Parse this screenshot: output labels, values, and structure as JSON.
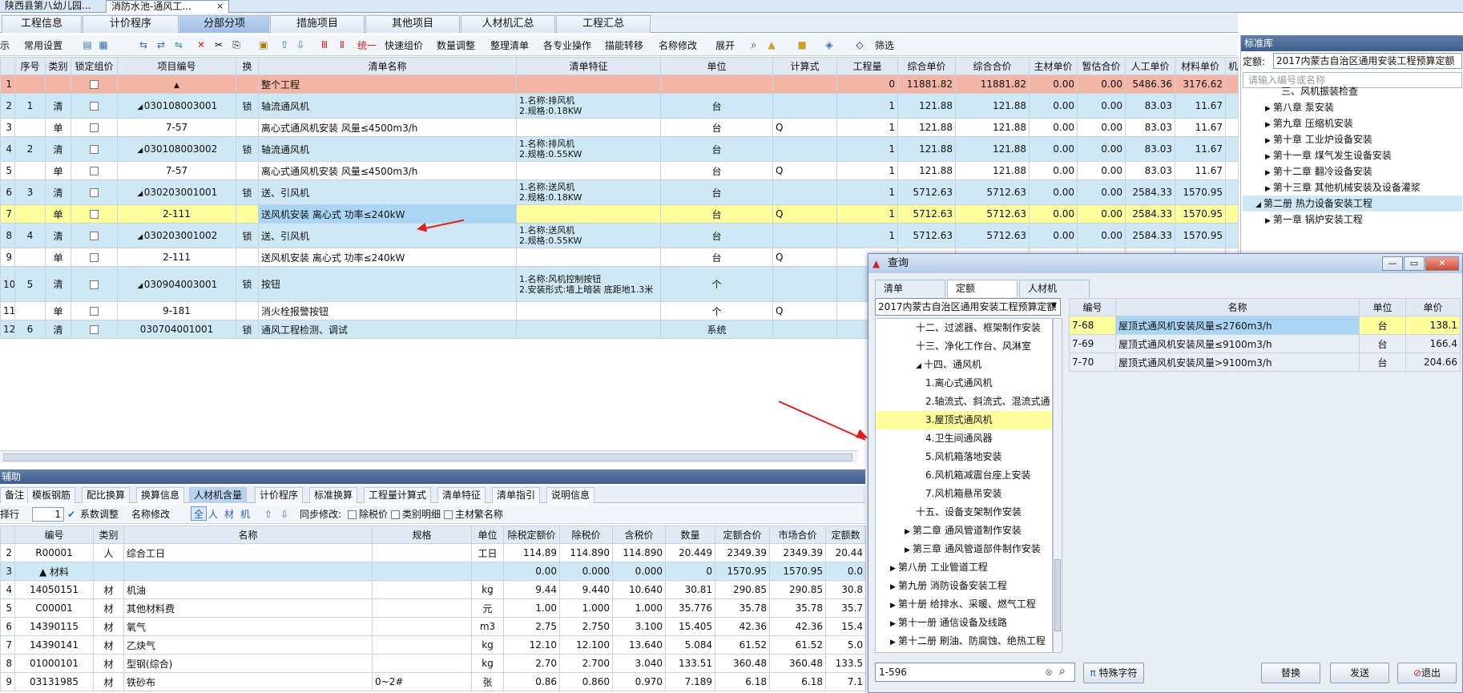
{
  "doc_tabs": [
    "陕西县第八幼儿园...",
    "消防水池-通风工...",
    "×"
  ],
  "main_tabs": [
    "工程信息",
    "计价程序",
    "分部分项",
    "措施项目",
    "其他项目",
    "人材机汇总",
    "工程汇总"
  ],
  "toolbar": [
    "示",
    "常用设置",
    "统一",
    "快速组价",
    "数量调整",
    "整理清单",
    "各专业操作",
    "描能转移",
    "名称修改",
    "展开",
    "筛选"
  ],
  "grid_headers": [
    "序号",
    "类别",
    "锁定组价",
    "项目编号",
    "换",
    "清单名称",
    "清单特征",
    "单位",
    "计算式",
    "工程量",
    "综合单价",
    "综合合价",
    "主材单价",
    "暂估合价",
    "人工单价",
    "材料单价",
    "机"
  ],
  "grid_rows": [
    {
      "n": "1",
      "seq": "",
      "type": "",
      "code": "",
      "name": "整个工程",
      "feat": "",
      "unit": "",
      "calc": "",
      "qty": "0",
      "up": "11881.82",
      "tp": "11881.82",
      "m": "0.00",
      "z": "0.00",
      "rg": "5486.36",
      "cl": "3176.62",
      "style": "salmon",
      "tri": "▲",
      "lock": ""
    },
    {
      "n": "2",
      "seq": "1",
      "type": "清",
      "code": "030108003001",
      "name": "轴流通风机",
      "feat": "1.名称:排风机\n2.规格:0.18KW",
      "unit": "台",
      "calc": "",
      "qty": "1",
      "up": "121.88",
      "tp": "121.88",
      "m": "0.00",
      "z": "0.00",
      "rg": "83.03",
      "cl": "11.67",
      "style": "blue",
      "tri": "◢",
      "lock": "锁"
    },
    {
      "n": "3",
      "seq": "",
      "type": "单",
      "code": "7-57",
      "name": "离心式通风机安装 风量≤4500m3/h",
      "feat": "",
      "unit": "台",
      "calc": "Q",
      "qty": "1",
      "up": "121.88",
      "tp": "121.88",
      "m": "0.00",
      "z": "0.00",
      "rg": "83.03",
      "cl": "11.67",
      "style": "white",
      "tri": "",
      "lock": ""
    },
    {
      "n": "4",
      "seq": "2",
      "type": "清",
      "code": "030108003002",
      "name": "轴流通风机",
      "feat": "1.名称:排风机\n2.规格:0.55KW",
      "unit": "台",
      "calc": "",
      "qty": "1",
      "up": "121.88",
      "tp": "121.88",
      "m": "0.00",
      "z": "0.00",
      "rg": "83.03",
      "cl": "11.67",
      "style": "blue",
      "tri": "◢",
      "lock": "锁"
    },
    {
      "n": "5",
      "seq": "",
      "type": "单",
      "code": "7-57",
      "name": "离心式通风机安装 风量≤4500m3/h",
      "feat": "",
      "unit": "台",
      "calc": "Q",
      "qty": "1",
      "up": "121.88",
      "tp": "121.88",
      "m": "0.00",
      "z": "0.00",
      "rg": "83.03",
      "cl": "11.67",
      "style": "white",
      "tri": "",
      "lock": ""
    },
    {
      "n": "6",
      "seq": "3",
      "type": "清",
      "code": "030203001001",
      "name": "送、引风机",
      "feat": "1.名称:送风机\n2.规格:0.18KW",
      "unit": "台",
      "calc": "",
      "qty": "1",
      "up": "5712.63",
      "tp": "5712.63",
      "m": "0.00",
      "z": "0.00",
      "rg": "2584.33",
      "cl": "1570.95",
      "style": "blue",
      "tri": "◢",
      "lock": "锁"
    },
    {
      "n": "7",
      "seq": "",
      "type": "单",
      "code": "2-111",
      "name": "送风机安装 离心式 功率≤240kW",
      "feat": "",
      "unit": "台",
      "calc": "Q",
      "qty": "1",
      "up": "5712.63",
      "tp": "5712.63",
      "m": "0.00",
      "z": "0.00",
      "rg": "2584.33",
      "cl": "1570.95",
      "style": "yellow",
      "tri": "",
      "lock": ""
    },
    {
      "n": "8",
      "seq": "4",
      "type": "清",
      "code": "030203001002",
      "name": "送、引风机",
      "feat": "1.名称:送风机\n2.规格:0.55KW",
      "unit": "台",
      "calc": "",
      "qty": "1",
      "up": "5712.63",
      "tp": "5712.63",
      "m": "0.00",
      "z": "0.00",
      "rg": "2584.33",
      "cl": "1570.95",
      "style": "blue",
      "tri": "◢",
      "lock": "锁"
    },
    {
      "n": "9",
      "seq": "",
      "type": "单",
      "code": "2-111",
      "name": "送风机安装 离心式 功率≤240kW",
      "feat": "",
      "unit": "台",
      "calc": "Q",
      "qty": "",
      "up": "",
      "tp": "",
      "m": "",
      "z": "",
      "rg": "",
      "cl": "",
      "style": "white",
      "tri": "",
      "lock": ""
    },
    {
      "n": "10",
      "seq": "5",
      "type": "清",
      "code": "030904003001",
      "name": "按钮",
      "feat": "1.名称:风机控制按钮\n2.安装形式:墙上暗装 底距地1.3米",
      "unit": "个",
      "calc": "",
      "qty": "",
      "up": "",
      "tp": "",
      "m": "",
      "z": "",
      "rg": "",
      "cl": "",
      "style": "blue",
      "tri": "◢",
      "lock": "锁"
    },
    {
      "n": "11",
      "seq": "",
      "type": "单",
      "code": "9-181",
      "name": "消火栓报警按钮",
      "feat": "",
      "unit": "个",
      "calc": "Q",
      "qty": "",
      "up": "",
      "tp": "",
      "m": "",
      "z": "",
      "rg": "",
      "cl": "",
      "style": "white",
      "tri": "",
      "lock": ""
    },
    {
      "n": "12",
      "seq": "6",
      "type": "清",
      "code": "030704001001",
      "name": "通风工程检测、调试",
      "feat": "",
      "unit": "系统",
      "calc": "",
      "qty": "",
      "up": "",
      "tp": "",
      "m": "",
      "z": "",
      "rg": "",
      "cl": "",
      "style": "blue",
      "tri": "",
      "lock": "锁"
    }
  ],
  "section_title": "辅助",
  "sub_tabs": [
    "备注",
    "模板钢筋",
    "配比换算",
    "换算信息",
    "人材机含量",
    "计价程序",
    "标准换算",
    "工程量计算式",
    "清单特征",
    "清单指引",
    "说明信息"
  ],
  "toolbar2": {
    "label1": "择行",
    "value1": "1",
    "check1": "系数调整",
    "name_mod": "名称修改",
    "seg": [
      "全",
      "人",
      "材",
      "机"
    ],
    "sync": "同步修改:",
    "c1": "除税价",
    "c2": "类别明细",
    "c3": "主材繁名称"
  },
  "grid2_headers": [
    "编号",
    "类别",
    "名称",
    "规格",
    "单位",
    "除税定额价",
    "除税价",
    "含税价",
    "数量",
    "定额合价",
    "市场合价",
    "定额数"
  ],
  "grid2_rows": [
    {
      "n": "2",
      "code": "R00001",
      "type": "人",
      "name": "综合工日",
      "spec": "",
      "unit": "工日",
      "a": "114.89",
      "b": "114.890",
      "c": "114.890",
      "d": "20.449",
      "e": "2349.39",
      "f": "2349.39",
      "g": "20.44",
      "style": "white"
    },
    {
      "n": "3",
      "code": "▲ 材料",
      "type": "",
      "name": "",
      "spec": "",
      "unit": "",
      "a": "0.00",
      "b": "0.000",
      "c": "0.000",
      "d": "0",
      "e": "1570.95",
      "f": "1570.95",
      "g": "0.0",
      "style": "blue"
    },
    {
      "n": "4",
      "code": "14050151",
      "type": "材",
      "name": "机油",
      "spec": "",
      "unit": "kg",
      "a": "9.44",
      "b": "9.440",
      "c": "10.640",
      "d": "30.81",
      "e": "290.85",
      "f": "290.85",
      "g": "30.8",
      "style": "white"
    },
    {
      "n": "5",
      "code": "C00001",
      "type": "材",
      "name": "其他材料费",
      "spec": "",
      "unit": "元",
      "a": "1.00",
      "b": "1.000",
      "c": "1.000",
      "d": "35.776",
      "e": "35.78",
      "f": "35.78",
      "g": "35.7",
      "style": "white"
    },
    {
      "n": "6",
      "code": "14390115",
      "type": "材",
      "name": "氧气",
      "spec": "",
      "unit": "m3",
      "a": "2.75",
      "b": "2.750",
      "c": "3.100",
      "d": "15.405",
      "e": "42.36",
      "f": "42.36",
      "g": "15.4",
      "style": "white"
    },
    {
      "n": "7",
      "code": "14390141",
      "type": "材",
      "name": "乙炔气",
      "spec": "",
      "unit": "kg",
      "a": "12.10",
      "b": "12.100",
      "c": "13.640",
      "d": "5.084",
      "e": "61.52",
      "f": "61.52",
      "g": "5.0",
      "style": "white"
    },
    {
      "n": "8",
      "code": "01000101",
      "type": "材",
      "name": "型钢(综合)",
      "spec": "",
      "unit": "kg",
      "a": "2.70",
      "b": "2.700",
      "c": "3.040",
      "d": "133.51",
      "e": "360.48",
      "f": "360.48",
      "g": "133.5",
      "style": "white"
    },
    {
      "n": "9",
      "code": "03131985",
      "type": "材",
      "name": "铁砂布",
      "spec": "0~2#",
      "unit": "张",
      "a": "0.86",
      "b": "0.860",
      "c": "0.970",
      "d": "7.189",
      "e": "6.18",
      "f": "6.18",
      "g": "7.1",
      "style": "white"
    }
  ],
  "side_panel": {
    "title": "标准库",
    "label": "定额:",
    "lib": "2017内蒙古自治区通用安装工程预算定额",
    "search_placeholder": "请输入编号或名称",
    "items": [
      "三、风机振装检查",
      "第八章 泵安装",
      "第九章 压缩机安装",
      "第十章 工业炉设备安装",
      "第十一章 煤气发生设备安装",
      "第十二章 翻冷设备安装",
      "第十三章 其他机械安装及设备灌浆",
      "第二册 热力设备安装工程",
      "第一章 锅炉安装工程"
    ]
  },
  "dialog": {
    "title": "查询",
    "tabs": [
      "清单",
      "定额",
      "人材机"
    ],
    "lib": "2017内蒙古自治区通用安装工程预算定额",
    "tree": [
      "十二、过滤器、框架制作安装",
      "十三、净化工作台、风淋室",
      "十四、通风机",
      "1.离心式通风机",
      "2.轴流式、斜流式、混流式通",
      "3.屋顶式通风机",
      "4.卫生间通风器",
      "5.风机箱落地安装",
      "6.风机箱减震台座上安装",
      "7.风机箱悬吊安装",
      "十五、设备支架制作安装",
      "第二章 通风管道制作安装",
      "第三章 通风管道部件制作安装",
      "第八册 工业管道工程",
      "第九册 消防设备安装工程",
      "第十册 给排水、采暖、燃气工程",
      "第十一册 通信设备及线路",
      "第十二册 刷油、防腐蚀、绝热工程"
    ],
    "grid_headers": [
      "编号",
      "名称",
      "单位",
      "单价"
    ],
    "grid_rows": [
      {
        "code": "7-68",
        "name": "屋顶式通风机安装风量≤2760m3/h",
        "unit": "台",
        "price": "138.1"
      },
      {
        "code": "7-69",
        "name": "屋顶式通风机安装风量≤9100m3/h",
        "unit": "台",
        "price": "166.4"
      },
      {
        "code": "7-70",
        "name": "屋顶式通风机安装风量>9100m3/h",
        "unit": "台",
        "price": "204.66"
      }
    ],
    "search_value": "1-596",
    "btn_special": "特殊字符",
    "btn_replace": "替换",
    "btn_send": "发送",
    "btn_exit": "退出"
  },
  "colors": {
    "accent": "#4a6fa5",
    "highlight": "#ffff9e",
    "arrow": "#e02020"
  }
}
